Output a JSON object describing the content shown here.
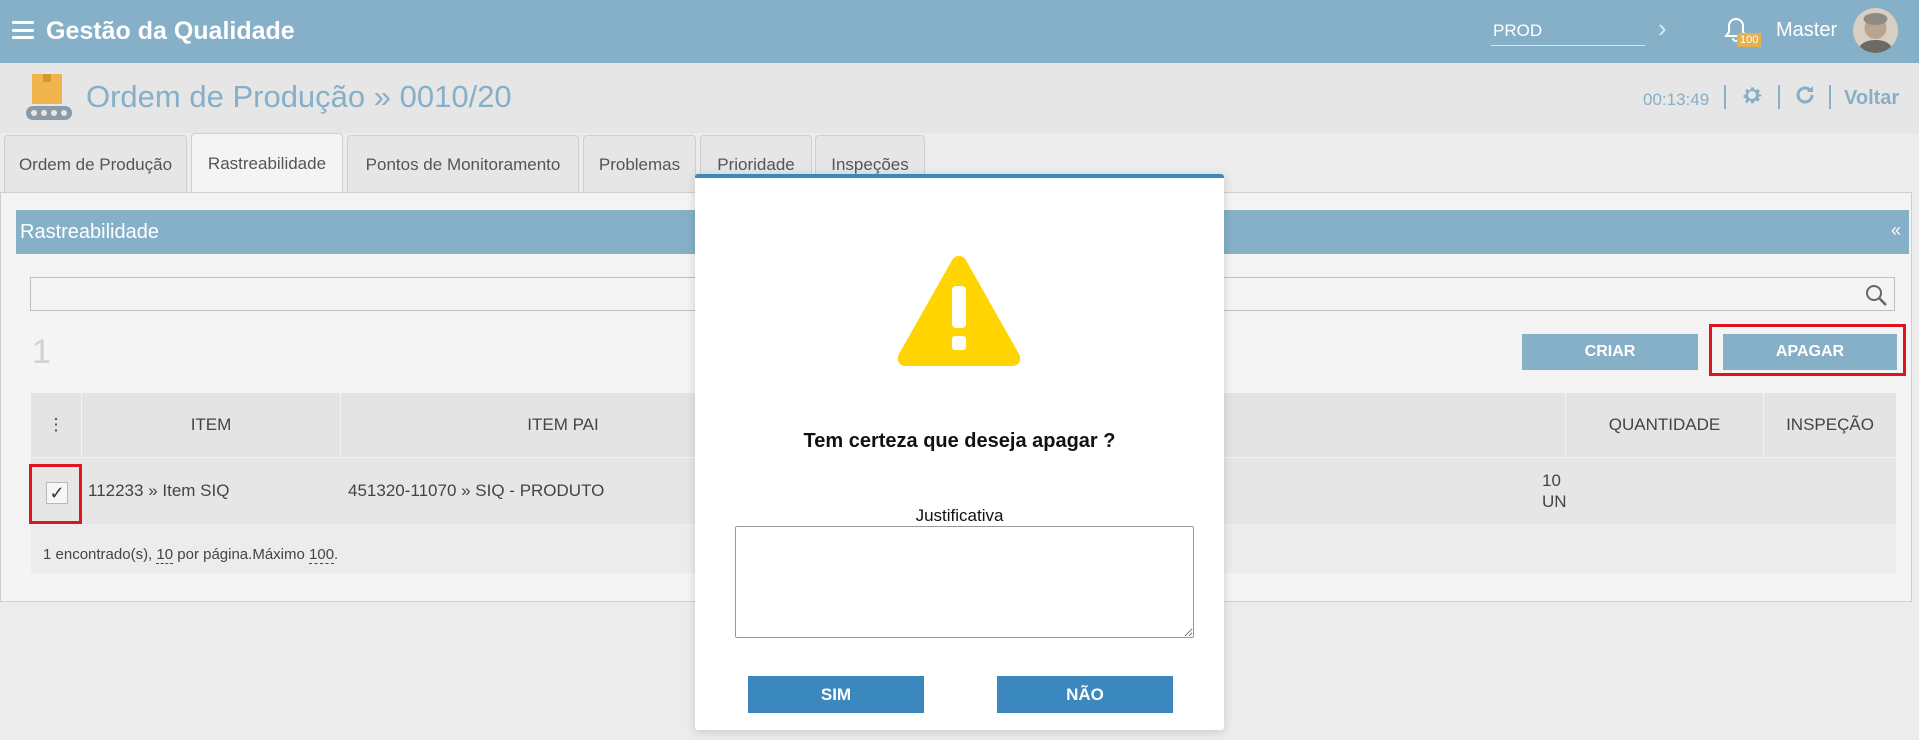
{
  "app": {
    "title": "Gestão da Qualidade",
    "environment": "PROD",
    "notification_count": "100",
    "user": "Master"
  },
  "header": {
    "title": "Ordem de Produção » 0010/20",
    "timer": "00:13:49",
    "back_label": "Voltar"
  },
  "tabs": [
    {
      "label": "Ordem de Produção"
    },
    {
      "label": "Rastreabilidade"
    },
    {
      "label": "Pontos de Monitoramento"
    },
    {
      "label": "Problemas"
    },
    {
      "label": "Prioridade"
    },
    {
      "label": "Inspeções"
    }
  ],
  "panel": {
    "title": "Rastreabilidade",
    "collapse_glyph": "«",
    "search_value": "",
    "count": "1",
    "create_label": "CRIAR",
    "delete_label": "APAGAR"
  },
  "table": {
    "menu_glyph": "⋮",
    "columns": [
      "ITEM",
      "ITEM PAI",
      "QUANTIDADE",
      "INSPEÇÃO"
    ],
    "rows": [
      {
        "item": "112233 » Item SIQ",
        "parent": "451320-11070 » SIQ - PRODUTO",
        "qty": "10",
        "unit": "UN",
        "inspection": "",
        "check": "✓"
      }
    ],
    "footer": {
      "found": "1 encontrado(s), ",
      "per_page": "10",
      "per_page_suffix": " por página.",
      "max_prefix": "Máximo ",
      "max": "100",
      "end": "."
    }
  },
  "modal": {
    "message": "Tem certeza que deseja apagar ?",
    "justification_label": "Justificativa",
    "justification_value": "",
    "yes_label": "SIM",
    "no_label": "NÃO"
  },
  "colors": {
    "primary": "#86afc8",
    "modal_button": "#3b88be",
    "warning": "#ffd400",
    "highlight": "#e0141e"
  }
}
